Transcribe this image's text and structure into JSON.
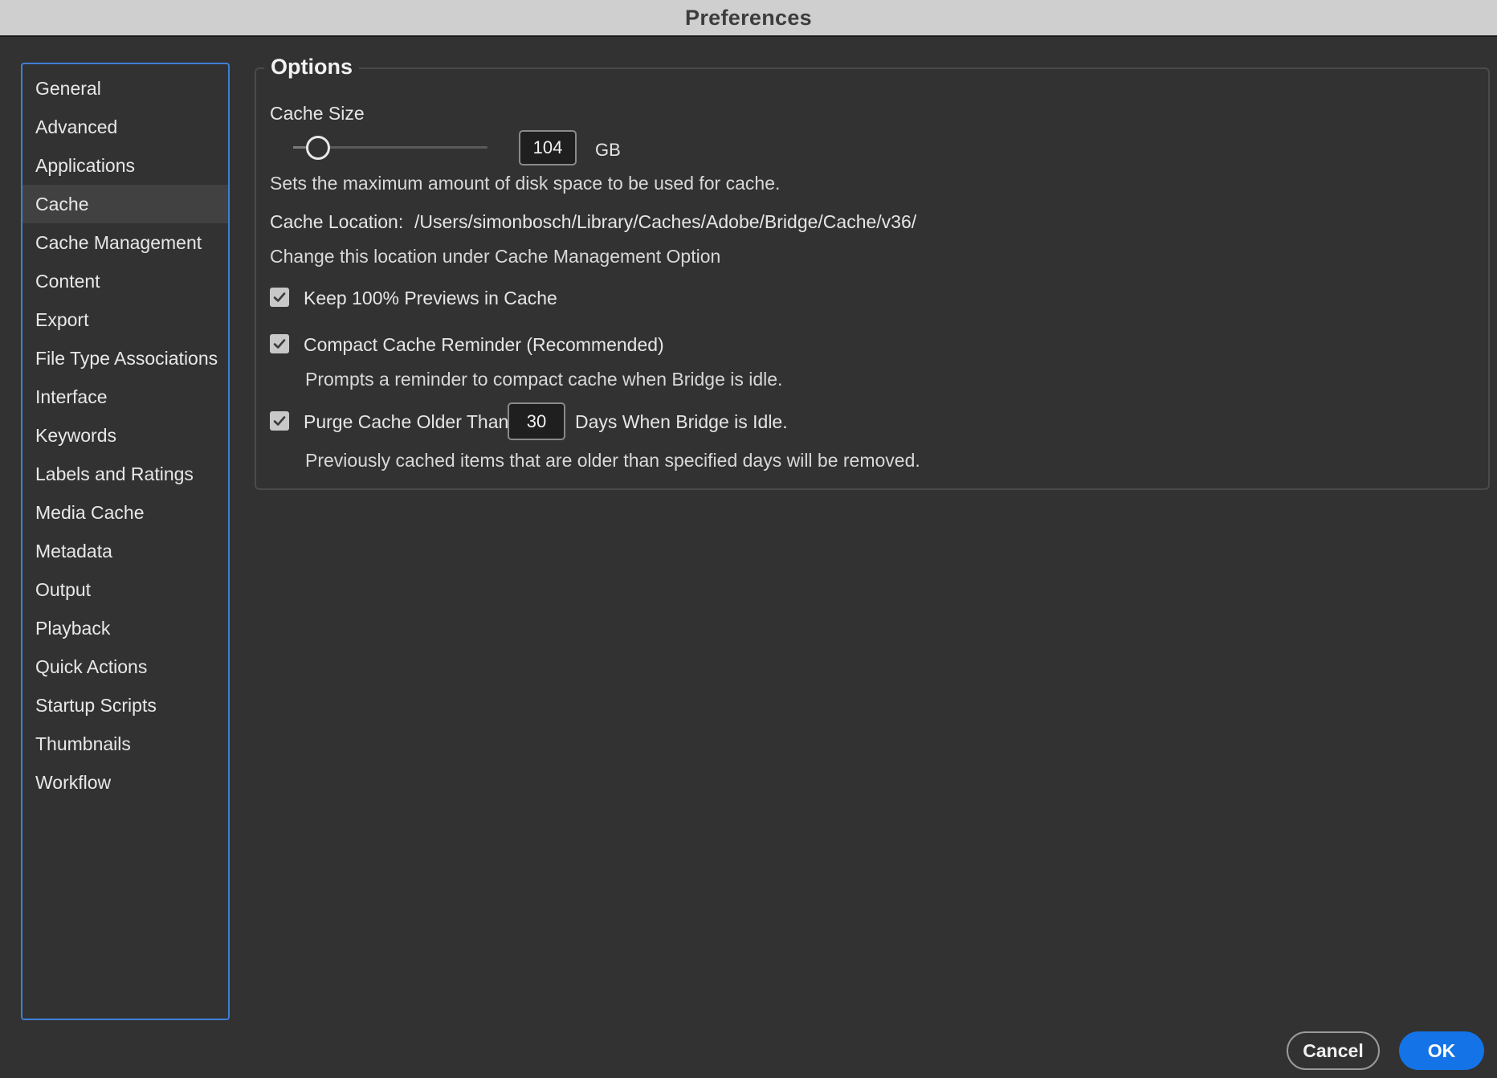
{
  "window": {
    "title": "Preferences"
  },
  "sidebar": {
    "items": [
      {
        "label": "General"
      },
      {
        "label": "Advanced"
      },
      {
        "label": "Applications"
      },
      {
        "label": "Cache",
        "selected": true
      },
      {
        "label": "Cache Management"
      },
      {
        "label": "Content"
      },
      {
        "label": "Export"
      },
      {
        "label": "File Type Associations"
      },
      {
        "label": "Interface"
      },
      {
        "label": "Keywords"
      },
      {
        "label": "Labels and Ratings"
      },
      {
        "label": "Media Cache"
      },
      {
        "label": "Metadata"
      },
      {
        "label": "Output"
      },
      {
        "label": "Playback"
      },
      {
        "label": "Quick Actions"
      },
      {
        "label": "Startup Scripts"
      },
      {
        "label": "Thumbnails"
      },
      {
        "label": "Workflow"
      }
    ]
  },
  "options": {
    "legend": "Options",
    "cache_size": {
      "label": "Cache Size",
      "value": "104",
      "unit": "GB",
      "slider_level": 0.1,
      "help": "Sets the maximum amount of disk space to be used for cache."
    },
    "cache_location": {
      "label": "Cache Location:",
      "path": "/Users/simonbosch/Library/Caches/Adobe/Bridge/Cache/v36/",
      "help": "Change this location under Cache Management Option"
    },
    "keep_previews": {
      "label": "Keep 100% Previews in Cache",
      "checked": true
    },
    "compact_reminder": {
      "label": "Compact Cache Reminder (Recommended)",
      "checked": true,
      "help": "Prompts a reminder to compact cache when Bridge is idle."
    },
    "purge": {
      "label": "Purge Cache Older Than",
      "days": "30",
      "suffix": "Days When Bridge is Idle.",
      "checked": true,
      "help": "Previously cached items that are older than specified days will be removed."
    }
  },
  "buttons": {
    "cancel_label": "Cancel",
    "ok_label": "OK"
  },
  "colors": {
    "accent": "#1473e6",
    "sidebar_border": "#3f7fd6",
    "background": "#323232",
    "titlebar": "#cfcfcf"
  }
}
